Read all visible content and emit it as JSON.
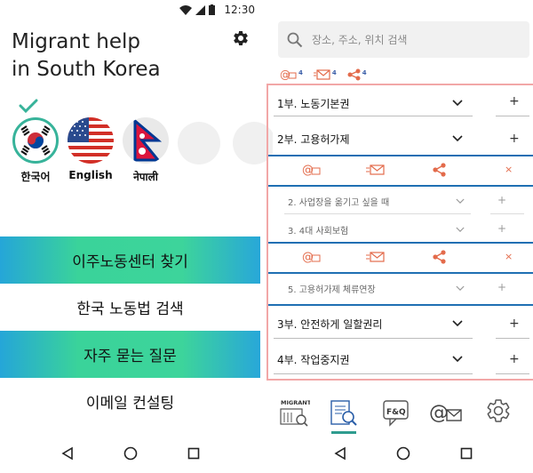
{
  "status": {
    "time": "12:30"
  },
  "left": {
    "title_line1": "Migrant help",
    "title_line2": "in South Korea",
    "languages": [
      {
        "label": "한국어",
        "flag": "korea-flag",
        "selected": true
      },
      {
        "label": "English",
        "flag": "usa-flag",
        "selected": false
      },
      {
        "label": "नेपाली",
        "flag": "nepal-flag",
        "selected": false
      }
    ],
    "menu": [
      {
        "label": "이주노동센터 찾기"
      },
      {
        "label": "한국 노동법 검색"
      },
      {
        "label": "자주 묻는 질문"
      },
      {
        "label": "이메일 컨설팅"
      }
    ]
  },
  "right": {
    "search_placeholder": "장소, 주소, 위치 검색",
    "share_counts": [
      "4",
      "4",
      "4"
    ],
    "sections": {
      "s1": "1부. 노동기본권",
      "s2": "2부. 고용허가제",
      "s2_1": "2. 사업장을 옮기고 싶을 때",
      "s2_2": "3. 4대 사회보험",
      "s2_3": "5. 고용허가제 체류연장",
      "s3": "3부. 안전하게 일할권리",
      "s4": "4부. 작업중지권"
    },
    "close_symbol": "×",
    "plus_symbol": "+",
    "tabs": [
      {
        "label": "MIGRANT",
        "icon": "migrant-center-icon"
      },
      {
        "label": "",
        "icon": "law-search-icon"
      },
      {
        "label": "F&Q",
        "icon": "faq-icon"
      },
      {
        "label": "",
        "icon": "email-icon"
      },
      {
        "label": "",
        "icon": "settings-icon"
      }
    ]
  },
  "colors": {
    "accent_orange": "#e36b4b",
    "divider_blue": "#1f6fb3",
    "frame_pink": "#f2a7a7"
  }
}
